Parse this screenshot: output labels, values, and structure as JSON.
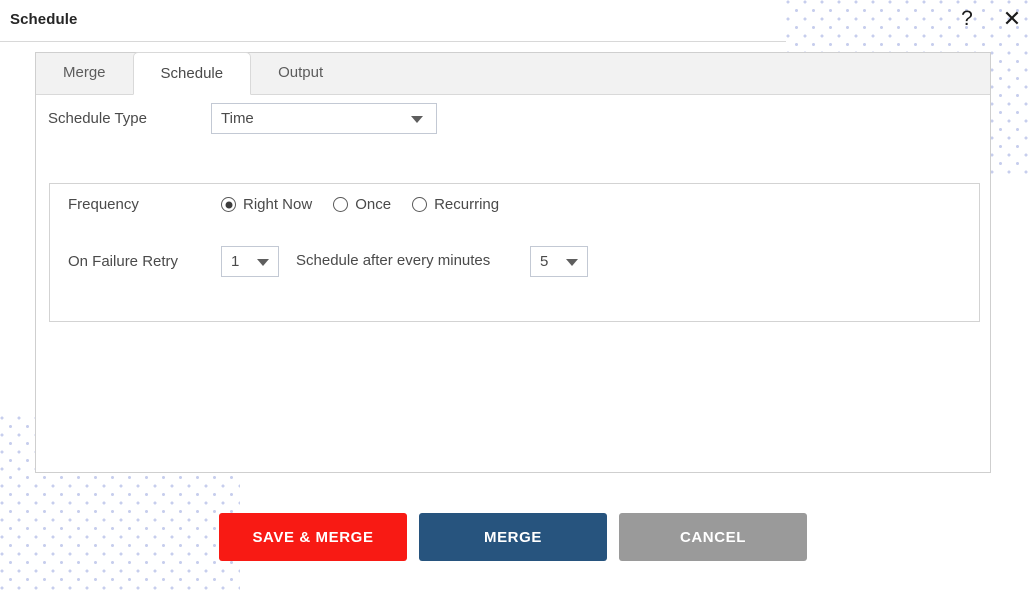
{
  "window": {
    "title": "Schedule",
    "help_icon": "question-mark-icon",
    "close_icon": "close-icon"
  },
  "tabs": [
    {
      "label": "Merge",
      "active": false
    },
    {
      "label": "Schedule",
      "active": true
    },
    {
      "label": "Output",
      "active": false
    }
  ],
  "form": {
    "schedule_type": {
      "label": "Schedule Type",
      "value": "Time",
      "options": [
        "Time"
      ]
    },
    "frequency": {
      "label": "Frequency",
      "options": [
        {
          "label": "Right Now",
          "selected": true
        },
        {
          "label": "Once",
          "selected": false
        },
        {
          "label": "Recurring",
          "selected": false
        }
      ]
    },
    "on_failure_retry": {
      "label": "On Failure Retry",
      "value": "1",
      "options": [
        "1"
      ]
    },
    "schedule_after_every": {
      "label": "Schedule after every minutes",
      "value": "5",
      "options": [
        "5"
      ]
    }
  },
  "footer": {
    "save_merge_label": "SAVE & MERGE",
    "merge_label": "MERGE",
    "cancel_label": "CANCEL"
  },
  "colors": {
    "save_merge": "#f81a14",
    "merge": "#27547e",
    "cancel": "#9a9a9a",
    "dots": "#9aa7e0",
    "tab_bar": "#f2f2f2",
    "panel_border": "#cfcfcf"
  }
}
